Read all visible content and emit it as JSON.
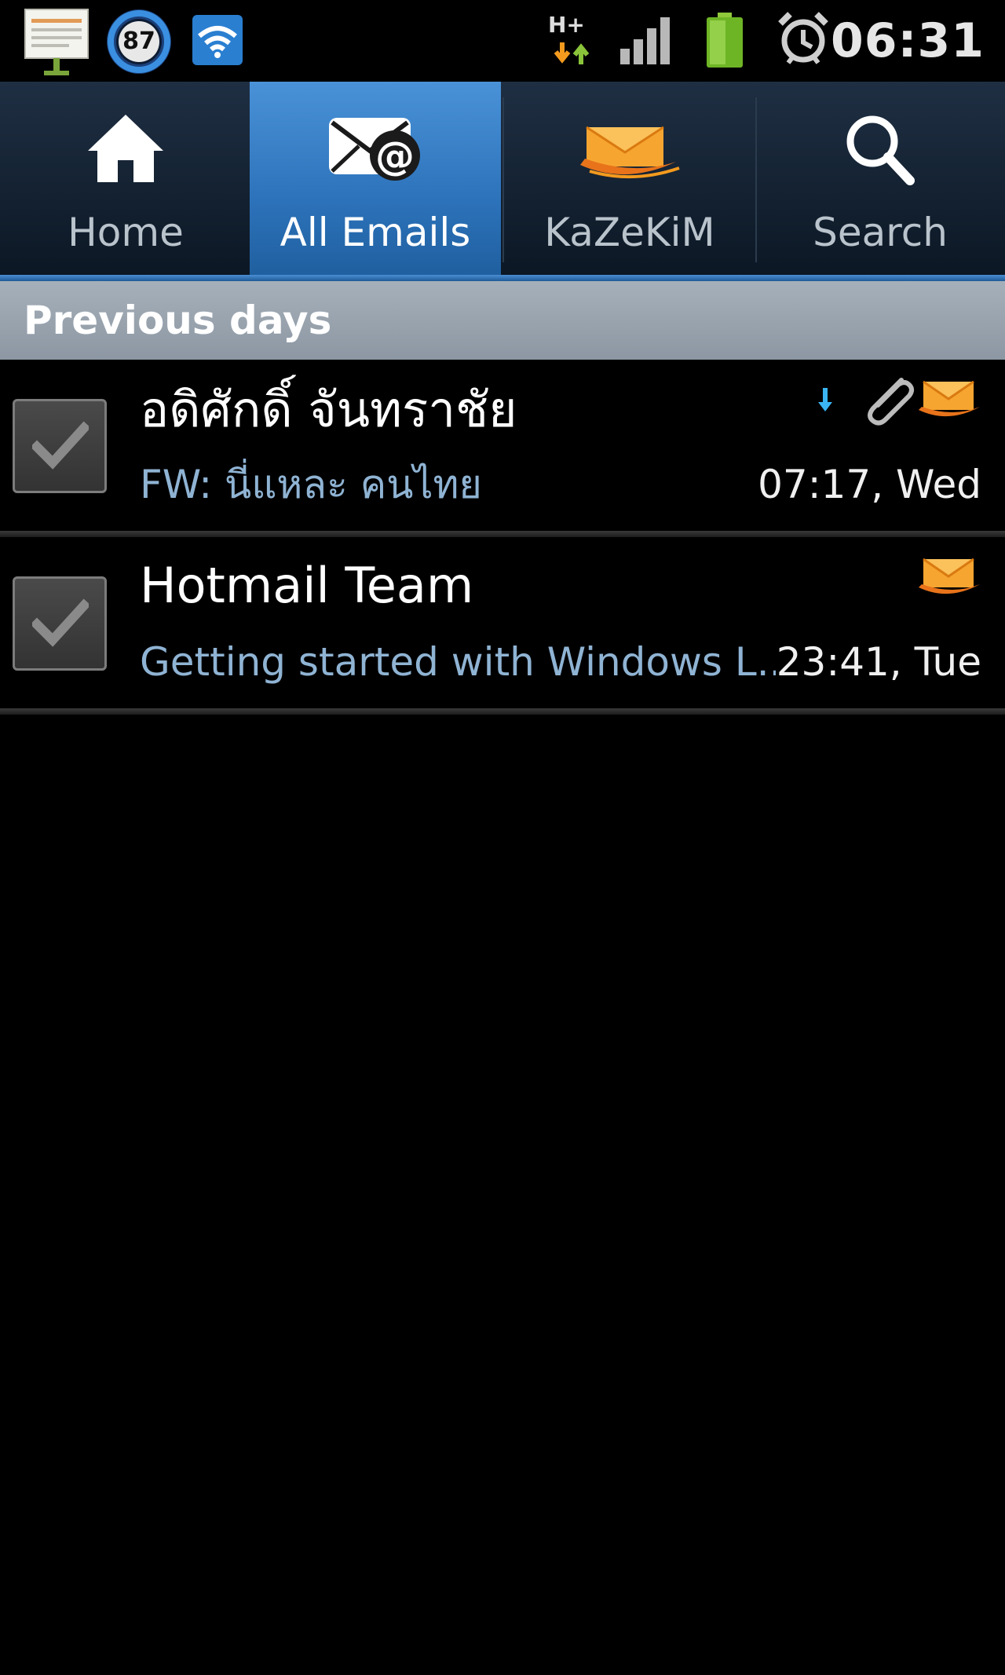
{
  "status_bar": {
    "battery_badge": "87",
    "network_type": "H+",
    "time": "06:31"
  },
  "tabs": [
    {
      "label": "Home",
      "icon": "home-icon",
      "active": false
    },
    {
      "label": "All Emails",
      "icon": "all-emails-icon",
      "active": true
    },
    {
      "label": "KaZeKiM",
      "icon": "hotmail-icon",
      "active": false
    },
    {
      "label": "Search",
      "icon": "search-icon",
      "active": false
    }
  ],
  "section": {
    "title": "Previous days"
  },
  "emails": [
    {
      "sender": "อดิศักดิ์ จันทราชัย",
      "subject": "FW: นี่แหละ คนไทย",
      "time": "07:17, Wed",
      "has_attachment": true,
      "downloaded_indicator": true
    },
    {
      "sender": "Hotmail Team",
      "subject": "Getting started with Windows L...",
      "time": "23:41, Tue",
      "has_attachment": false,
      "downloaded_indicator": false
    }
  ],
  "colors": {
    "active_tab": "#2d73bb",
    "accent_orange": "#f39a1e",
    "subject_text": "#8fb3d3"
  }
}
